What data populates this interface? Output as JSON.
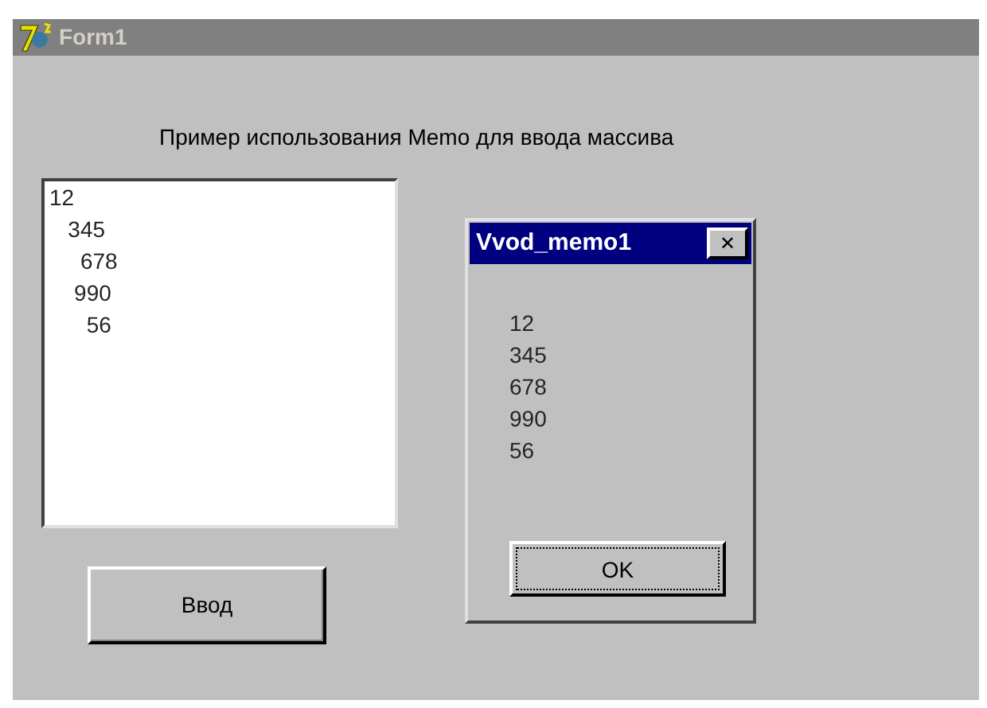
{
  "window": {
    "title": "Form1"
  },
  "label": "Пример использования  Memo для ввода массива",
  "memo": {
    "lines": [
      "12",
      "   345",
      "     678",
      "    990",
      "      56"
    ]
  },
  "button": "Ввод",
  "dialog": {
    "title": "Vvod_memo1",
    "close": "✕",
    "lines": [
      "12",
      "345",
      "678",
      "990",
      "56"
    ],
    "ok": "OK"
  }
}
